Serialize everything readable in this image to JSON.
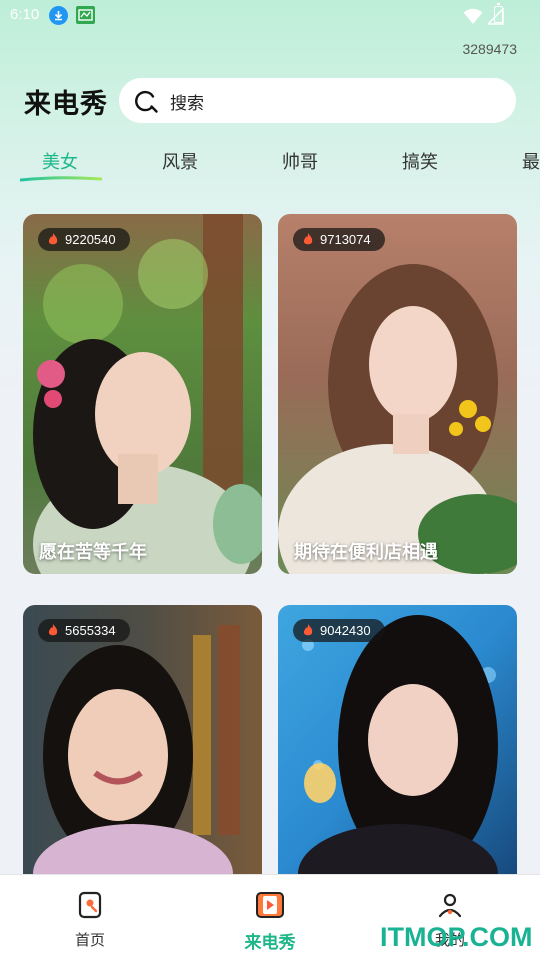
{
  "status_bar": {
    "time": "6:10"
  },
  "user_id": "3289473",
  "header": {
    "title": "来电秀",
    "search_label": "搜索"
  },
  "tabs": [
    {
      "label": "美女",
      "active": true
    },
    {
      "label": "风景",
      "active": false
    },
    {
      "label": "帅哥",
      "active": false
    },
    {
      "label": "搞笑",
      "active": false
    },
    {
      "label": "最",
      "active": false
    }
  ],
  "cards": [
    {
      "hot_count": "9220540",
      "title": "愿在苦等千年"
    },
    {
      "hot_count": "9713074",
      "title": "期待在便利店相遇"
    },
    {
      "hot_count": "5655334",
      "title": ""
    },
    {
      "hot_count": "9042430",
      "title": ""
    }
  ],
  "bottom_nav": [
    {
      "label": "首页",
      "icon": "home-phone-icon",
      "active": false
    },
    {
      "label": "来电秀",
      "icon": "call-show-icon",
      "active": true
    },
    {
      "label": "我的",
      "icon": "profile-icon",
      "active": false
    }
  ],
  "watermark": "ITMOP.COM",
  "colors": {
    "accent": "#1db78a",
    "badge_bg": "#1b1b1b"
  }
}
